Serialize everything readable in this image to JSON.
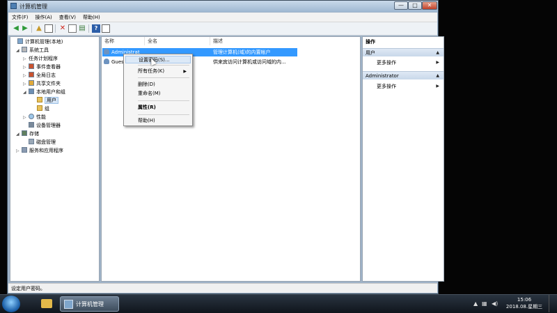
{
  "window": {
    "title": "计算机管理",
    "buttons": {
      "min": "—",
      "max": "□",
      "close": "✕"
    }
  },
  "menu": [
    "文件(F)",
    "操作(A)",
    "查看(V)",
    "帮助(H)"
  ],
  "toolbar": {
    "help_glyph": "?"
  },
  "tree": {
    "items": [
      {
        "label": "计算机管理(本地)",
        "expander": "",
        "icon": "comp"
      },
      {
        "label": "系统工具",
        "expander": "◢",
        "icon": "tools"
      },
      {
        "label": "任务计划程序",
        "expander": "▷",
        "icon": "clock"
      },
      {
        "label": "事件查看器",
        "expander": "▷",
        "icon": "log"
      },
      {
        "label": "全局日志",
        "expander": "▷",
        "icon": "log"
      },
      {
        "label": "共享文件夹",
        "expander": "▷",
        "icon": "share"
      },
      {
        "label": "本地用户和组",
        "expander": "◢",
        "icon": "users"
      },
      {
        "label": "用户",
        "expander": "",
        "icon": "folder"
      },
      {
        "label": "组",
        "expander": "",
        "icon": "folder"
      },
      {
        "label": "性能",
        "expander": "▷",
        "icon": "perf"
      },
      {
        "label": "设备管理器",
        "expander": "",
        "icon": "device"
      },
      {
        "label": "存储",
        "expander": "◢",
        "icon": "storage"
      },
      {
        "label": "磁盘管理",
        "expander": "",
        "icon": "disk"
      },
      {
        "label": "服务和应用程序",
        "expander": "▷",
        "icon": "svc"
      }
    ]
  },
  "list": {
    "columns": [
      "名称",
      "全名",
      "描述"
    ],
    "rows": [
      {
        "name": "Administrat",
        "fullname": "",
        "desc": "管理计算机(域)的内置帐户"
      },
      {
        "name": "Guest",
        "fullname": "",
        "desc": "供来宾访问计算机或访问域的内..."
      }
    ]
  },
  "context_menu": {
    "set_password": "设置密码(S)...",
    "all_tasks": "所有任务(K)",
    "delete": "删除(D)",
    "rename": "重命名(M)",
    "properties": "属性(R)",
    "help": "帮助(H)",
    "submenu_arrow": "▶"
  },
  "actions": {
    "header": "操作",
    "group1": "用户",
    "more1": "更多操作",
    "group2": "Administrator",
    "more2": "更多操作",
    "collapse": "▲",
    "arrow": "▶"
  },
  "status": "设定用户密码。",
  "taskbar": {
    "active_app": "计算机管理",
    "time": "15:06",
    "date": "2018.08.星期三"
  }
}
